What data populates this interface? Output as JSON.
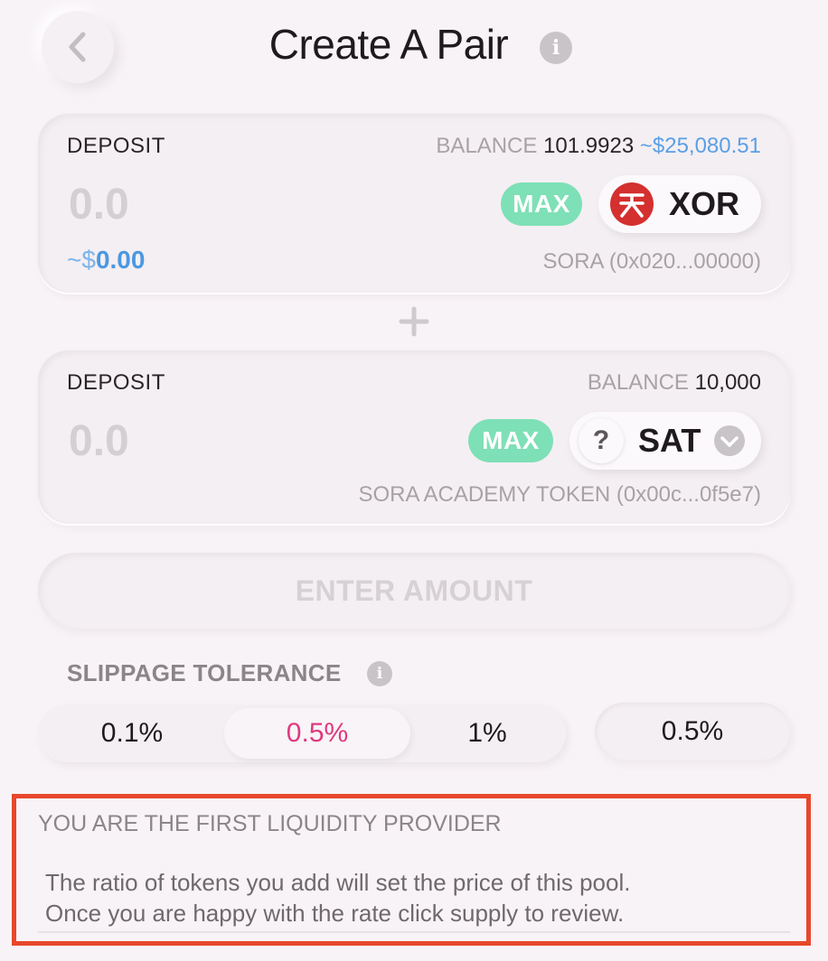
{
  "header": {
    "title": "Create A Pair"
  },
  "deposit_a": {
    "label": "DEPOSIT",
    "balance_label": "BALANCE",
    "balance_value": "101.9923",
    "balance_fiat_prefix": "~$",
    "balance_fiat": "25,080.51",
    "amount": "0.0",
    "usd_prefix": "~$",
    "usd_value": "0.00",
    "max_label": "MAX",
    "token_symbol": "XOR",
    "token_icon": "sora-logo-icon",
    "token_full": "SORA (0x020...00000)"
  },
  "deposit_b": {
    "label": "DEPOSIT",
    "balance_label": "BALANCE",
    "balance_value": "10,000",
    "amount": "0.0",
    "max_label": "MAX",
    "token_symbol": "SAT",
    "token_icon": "question-icon",
    "token_full": "SORA ACADEMY TOKEN (0x00c...0f5e7)"
  },
  "action_button": "ENTER AMOUNT",
  "slippage": {
    "title": "SLIPPAGE TOLERANCE",
    "options": [
      "0.1%",
      "0.5%",
      "1%"
    ],
    "selected": "0.5%",
    "custom_value": "0.5%"
  },
  "notice": {
    "title": "YOU ARE THE FIRST LIQUIDITY PROVIDER",
    "line1": "The ratio of tokens you add will set the price of this pool.",
    "line2": "Once you are happy with the rate click supply to review."
  },
  "colors": {
    "accent_pink": "#e0397f",
    "max_green": "#7ee0b6",
    "fiat_blue": "#4b98e0",
    "xor_red": "#d3302f",
    "highlight_border": "#e8472b"
  }
}
